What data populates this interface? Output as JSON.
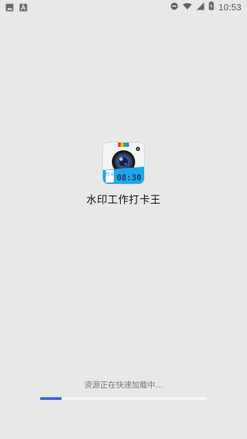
{
  "status_bar": {
    "time": "10:53",
    "left_icons": [
      "image-icon",
      "app-a-icon"
    ],
    "right_icons": [
      "do-not-disturb-icon",
      "wifi-icon",
      "signal-icon",
      "battery-charging-icon"
    ]
  },
  "app": {
    "name": "水印工作打卡王",
    "icon": {
      "name": "camera-lens-app-icon",
      "badge_text": "打卡",
      "time_text": "08:30"
    }
  },
  "loading": {
    "text": "资源正在快速加载中...",
    "progress": 0.13
  },
  "colors": {
    "background": "#e8e8e8",
    "progress_fill": "#3b62e6",
    "progress_track": "#f7f7f7",
    "icon_blue": "#1fa6e6"
  }
}
